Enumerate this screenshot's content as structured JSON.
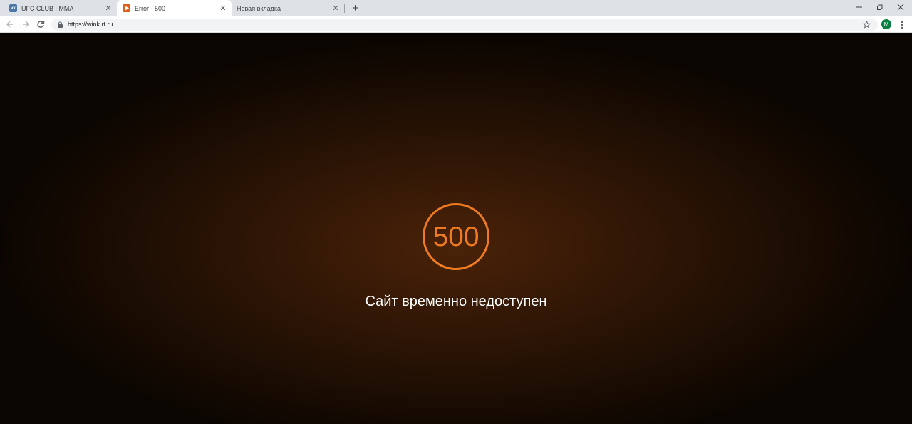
{
  "tabs": [
    {
      "title": "UFC CLUB | MMA",
      "favicon": "vk-icon"
    },
    {
      "title": "Error - 500",
      "favicon": "wink-play-icon",
      "active": true
    },
    {
      "title": "Новая вкладка",
      "favicon": "none"
    }
  ],
  "toolbar": {
    "url": "https://wink.rt.ru",
    "avatar_letter": "M"
  },
  "error": {
    "code": "500",
    "message": "Сайт временно недоступен"
  },
  "colors": {
    "accent": "#ee7b22",
    "background_center": "#4a2208",
    "background_edge": "#0b0501"
  }
}
